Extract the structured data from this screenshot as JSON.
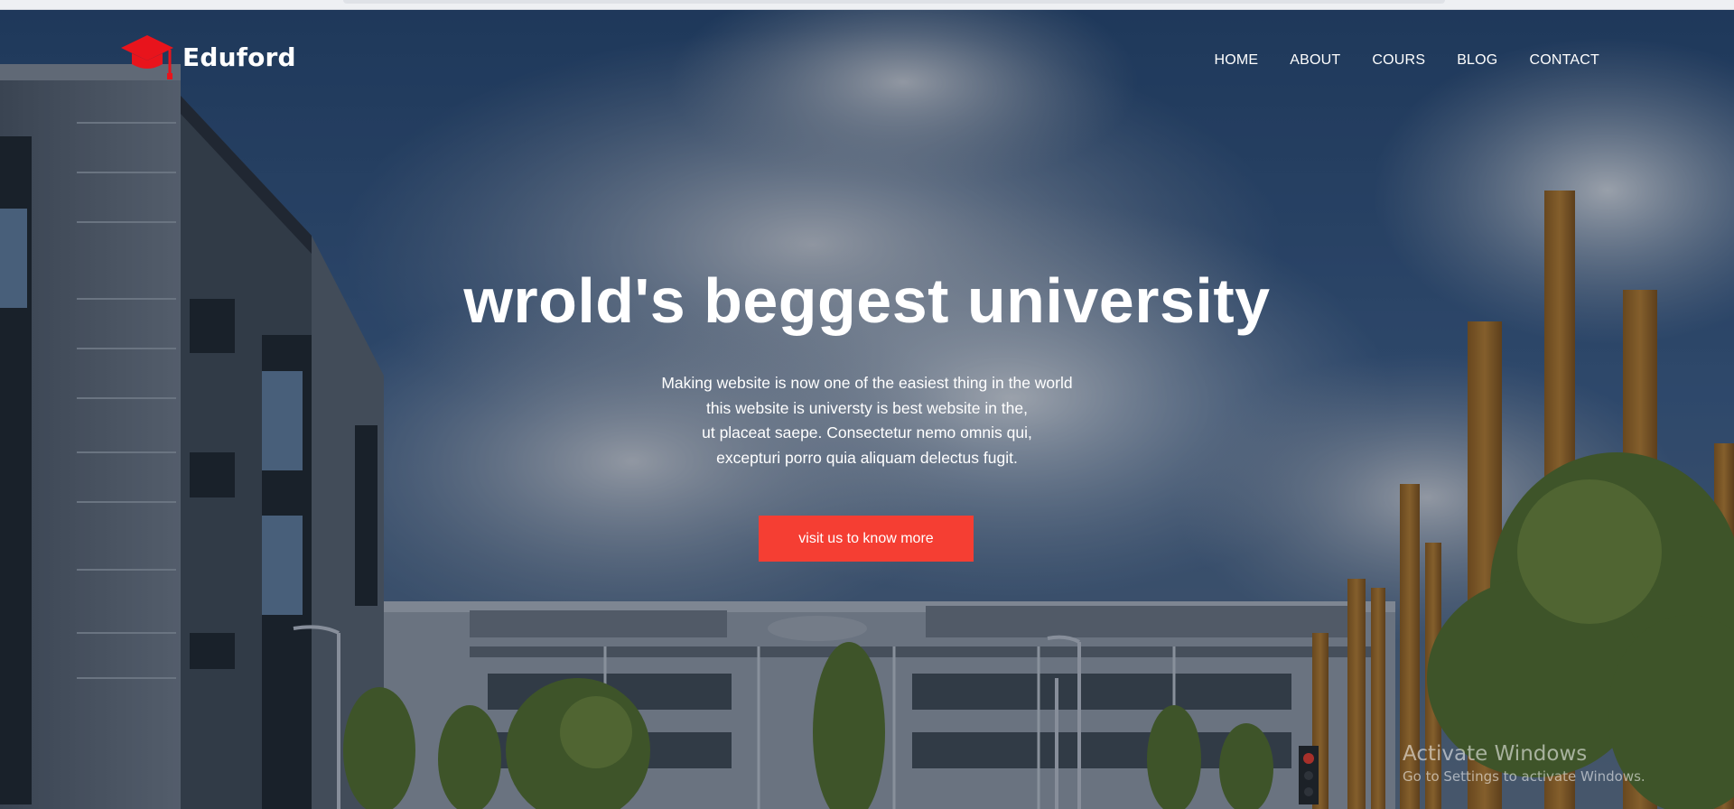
{
  "header": {
    "brand": "Eduford",
    "logo_icon": "graduation-cap-icon",
    "brand_color": "#e8141c",
    "nav": [
      {
        "label": "HOME"
      },
      {
        "label": "ABOUT"
      },
      {
        "label": "COURS"
      },
      {
        "label": "BLOG"
      },
      {
        "label": "CONTACT"
      }
    ]
  },
  "hero": {
    "title": "wrold's beggest university",
    "description": [
      "Making website is now one of the easiest thing in the world",
      "this website is universty is best website in the,",
      "ut placeat saepe. Consectetur nemo omnis qui,",
      "excepturi porro quia aliquam delectus fugit."
    ],
    "cta_label": "visit us to know more",
    "cta_color": "#f53e33"
  },
  "watermark": {
    "title": "Activate Windows",
    "subtitle": "Go to Settings to activate Windows."
  }
}
